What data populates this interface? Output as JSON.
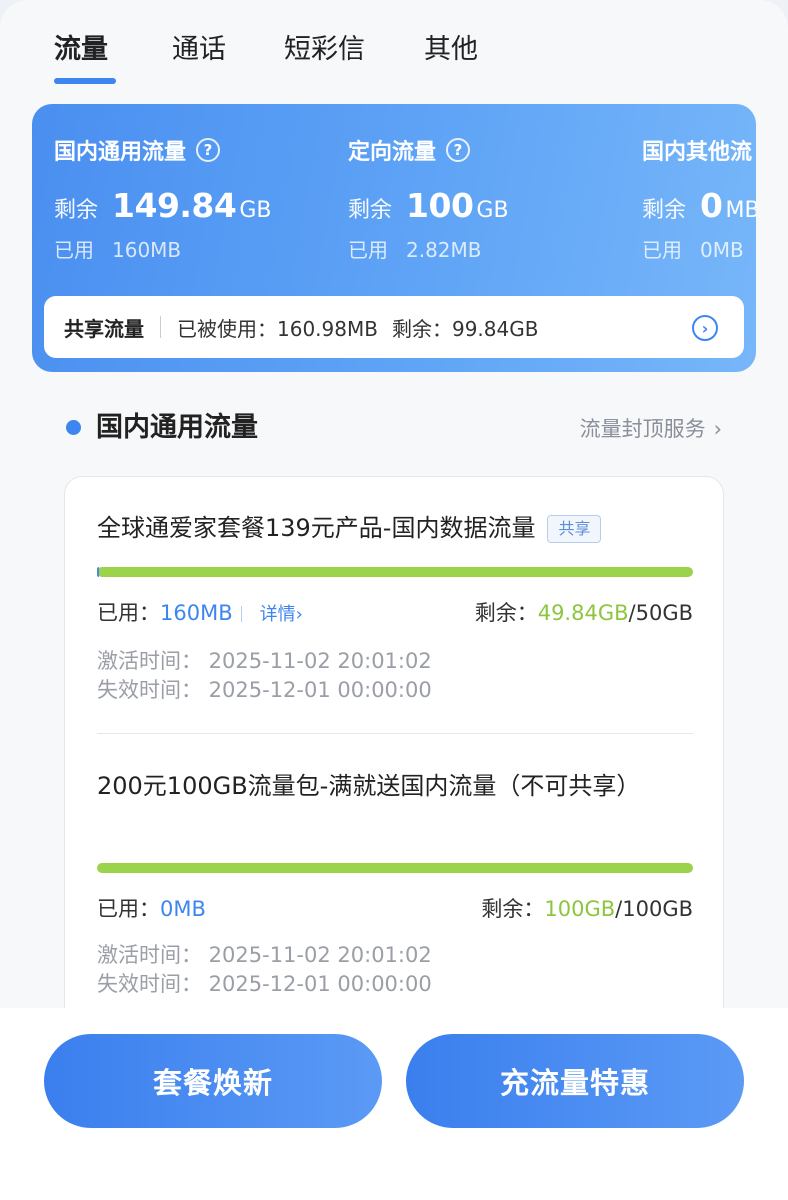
{
  "tabs": [
    "流量",
    "通话",
    "短彩信",
    "其他"
  ],
  "summary": {
    "columns": [
      {
        "title": "国内通用流量",
        "has_help": true,
        "remain_label": "剩余",
        "remain_value": "149.84",
        "remain_unit": "GB",
        "used_label": "已用",
        "used_value": "160MB"
      },
      {
        "title": "定向流量",
        "has_help": true,
        "remain_label": "剩余",
        "remain_value": "100",
        "remain_unit": "GB",
        "used_label": "已用",
        "used_value": "2.82MB"
      },
      {
        "title": "国内其他流",
        "has_help": false,
        "remain_label": "剩余",
        "remain_value": "0",
        "remain_unit": "MB",
        "used_label": "已用",
        "used_value": "0MB"
      }
    ],
    "help_glyph": "?",
    "share": {
      "title": "共享流量",
      "used": "已被使用：160.98MB",
      "remain": "剩余：99.84GB",
      "go_glyph": "›"
    }
  },
  "section": {
    "title": "国内通用流量",
    "link": "流量封顶服务",
    "chevron": "›"
  },
  "packages": [
    {
      "name": "全球通爱家套餐139元产品-国内数据流量",
      "tag": "共享",
      "used_label": "已用：",
      "used_value": "160MB",
      "detail": "详情",
      "detail_chevron": "›",
      "remain_label": "剩余：",
      "remain_value": "49.84GB",
      "total": "/50GB",
      "used_fraction": 0.003,
      "activate": "激活时间：  2025-11-02 20:01:02",
      "expire": "失效时间：  2025-12-01 00:00:00"
    },
    {
      "name": "200元100GB流量包-满就送国内流量（不可共享）",
      "used_label": "已用：",
      "used_value": "0MB",
      "remain_label": "剩余：",
      "remain_value": "100GB",
      "total": "/100GB",
      "used_fraction": 0,
      "activate": "激活时间：  2025-11-02 20:01:02",
      "expire": "失效时间：  2025-12-01 00:00:00"
    }
  ],
  "actions": {
    "renew": "套餐焕新",
    "recharge": "充流量特惠"
  },
  "colors": {
    "accent": "#3d86f0",
    "remain_green": "#8cc63f",
    "bar_green": "#9bd44a"
  }
}
